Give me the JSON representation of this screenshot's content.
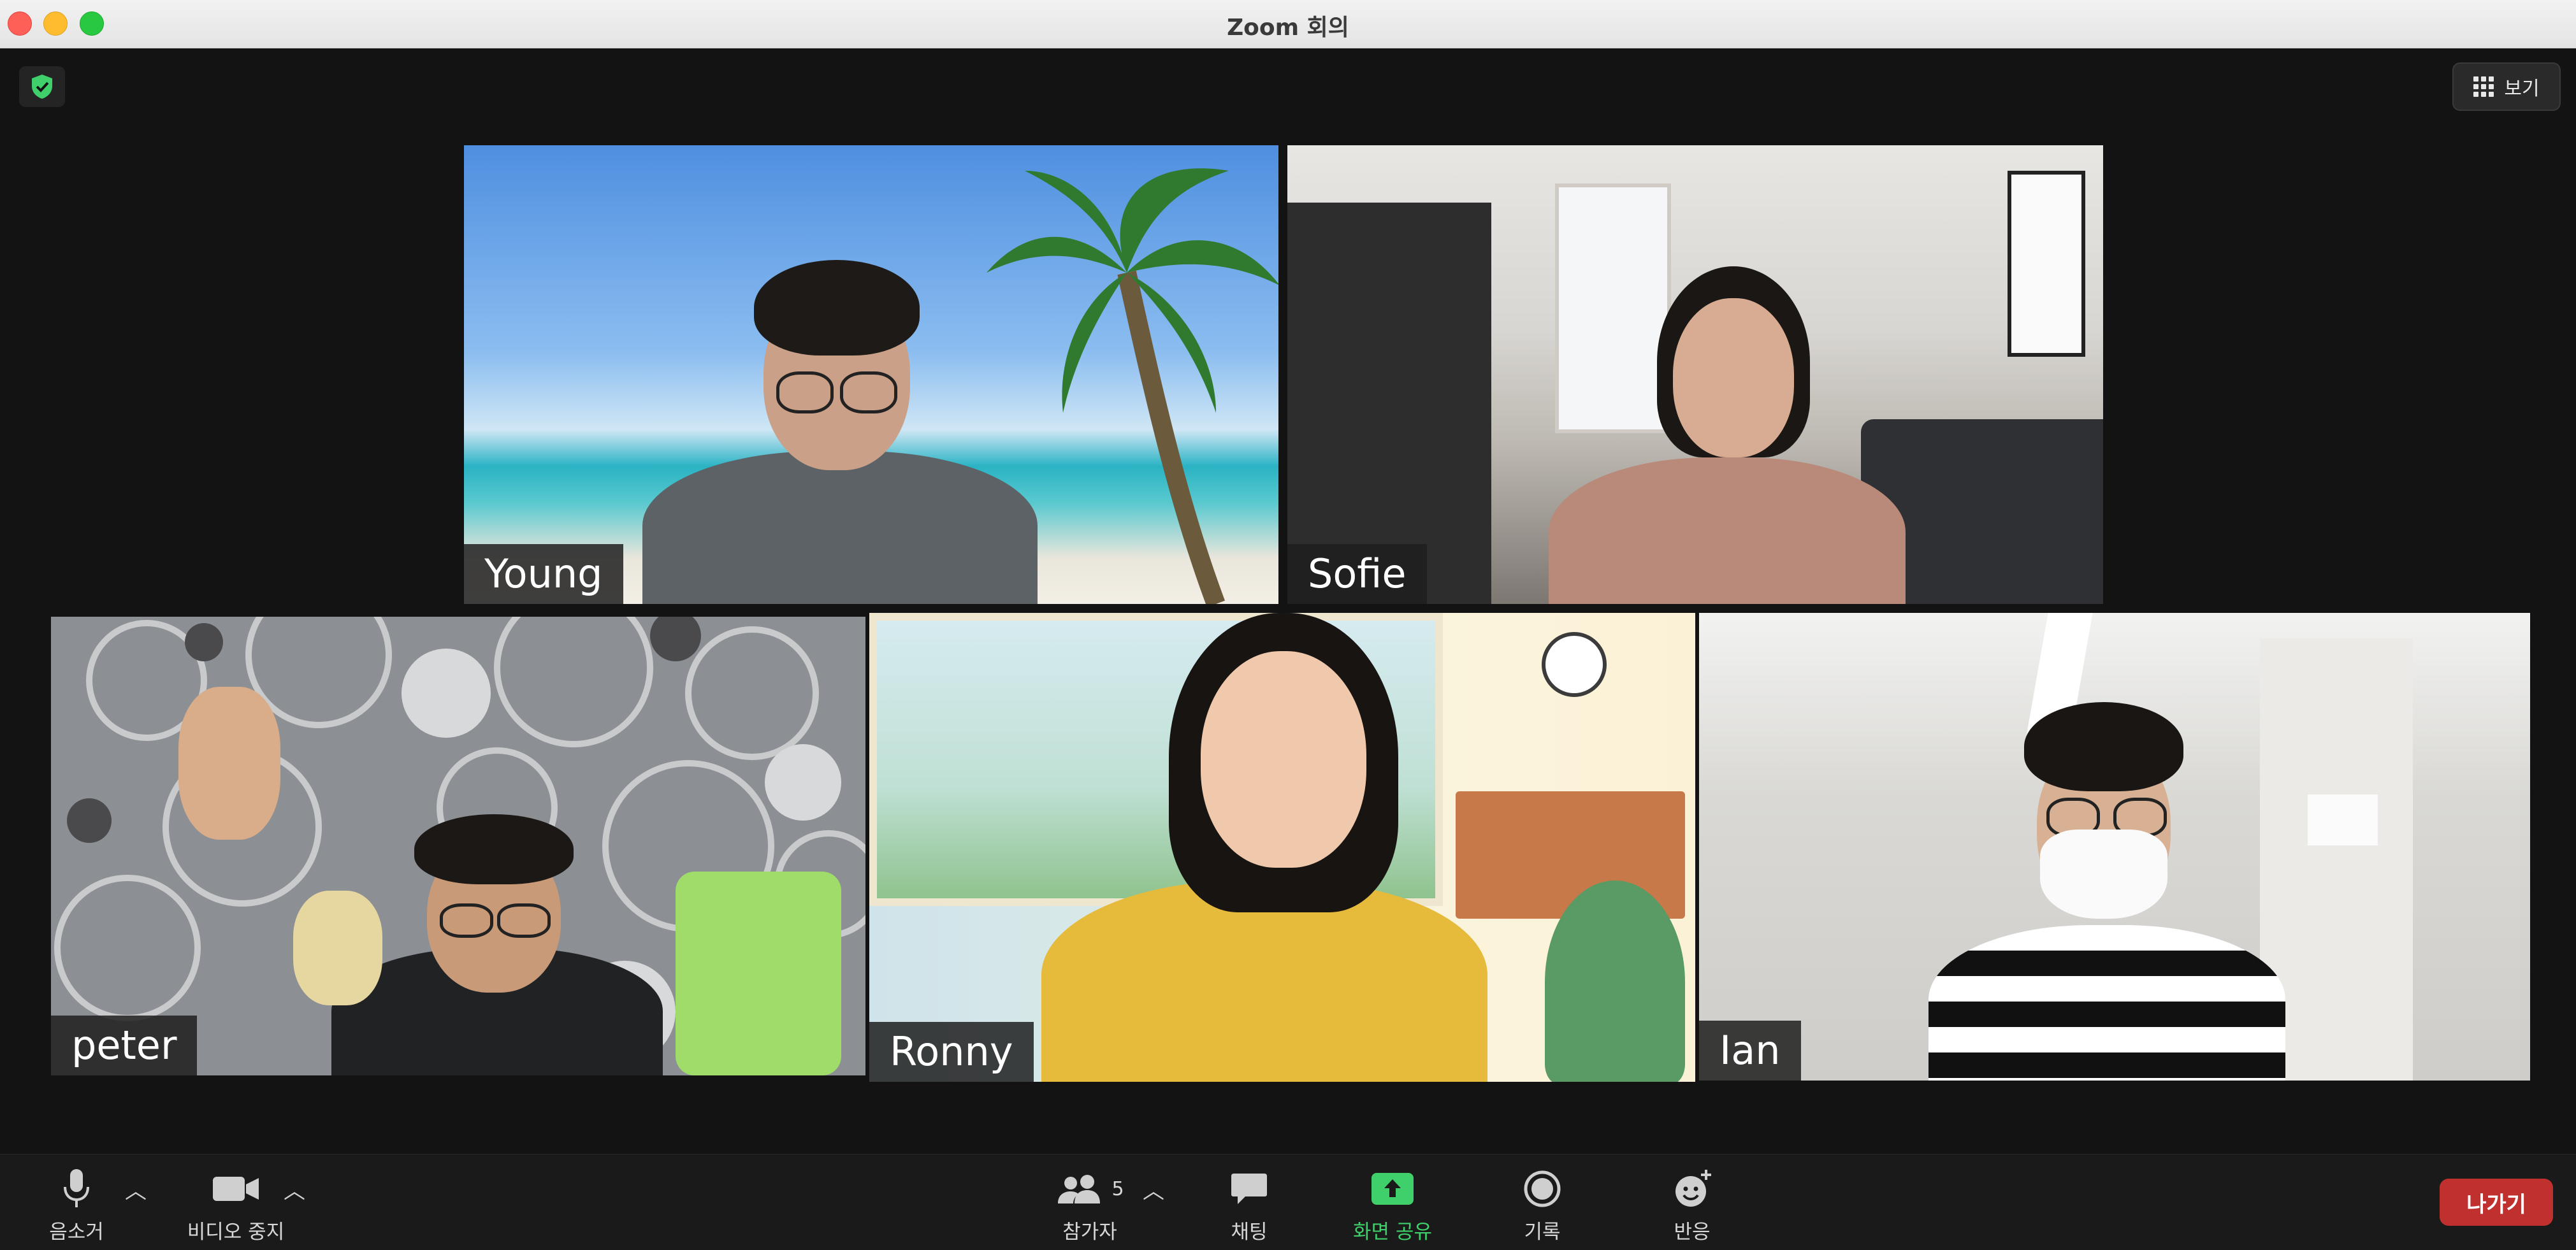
{
  "window": {
    "title": "Zoom 회의"
  },
  "header": {
    "view_label": "보기"
  },
  "participants": [
    {
      "name": "Young"
    },
    {
      "name": "Sofie"
    },
    {
      "name": "peter"
    },
    {
      "name": "Ronny"
    },
    {
      "name": "Ian"
    }
  ],
  "toolbar": {
    "mute_label": "음소거",
    "video_label": "비디오 중지",
    "participants_label": "참가자",
    "participants_count": "5",
    "chat_label": "채팅",
    "share_label": "화면 공유",
    "record_label": "기록",
    "reactions_label": "반응",
    "leave_label": "나가기"
  },
  "colors": {
    "share_accent": "#3fd06b",
    "leave": "#c0302e",
    "active_speaker": "#d7ec6f",
    "security": "#3fd06b"
  }
}
